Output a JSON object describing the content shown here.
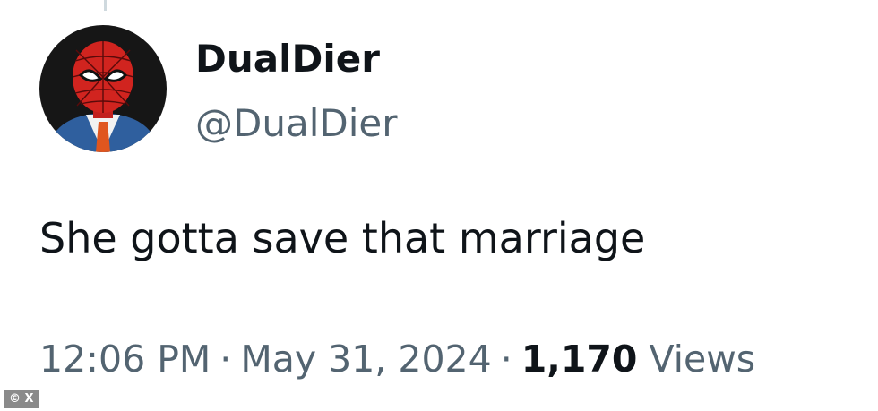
{
  "tweet": {
    "author": {
      "display_name": "DualDier",
      "handle": "@DualDier",
      "avatar_icon": "spiderman-suit-avatar"
    },
    "text": "She gotta save that marriage",
    "time": "12:06 PM",
    "separator": "·",
    "date": "May 31, 2024",
    "views_count": "1,170",
    "views_label": "Views"
  },
  "watermark": {
    "text": "© X"
  },
  "colors": {
    "text_primary": "#0f1419",
    "text_secondary": "#536471",
    "background": "#ffffff"
  }
}
